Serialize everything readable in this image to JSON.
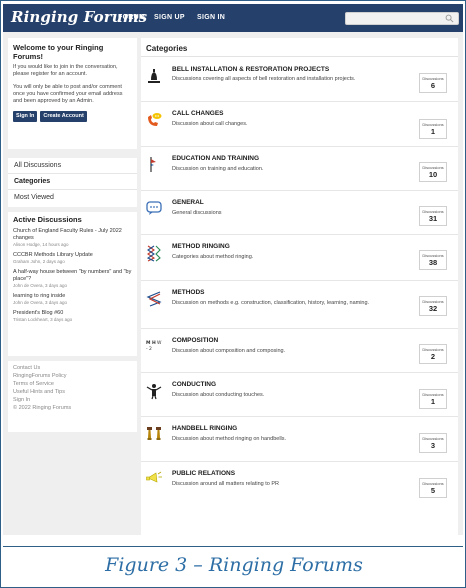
{
  "header": {
    "logo": "Ringing Forums",
    "nav": [
      "FORUM",
      "SIGN UP",
      "SIGN IN"
    ],
    "brand_color": "#25406a"
  },
  "welcome": {
    "title": "Welcome to your Ringing Forums!",
    "text1": "If you would like to join in the conversation, please register for an account.",
    "text2": "You will only be able to post and/or comment once you have confirmed your email address and been approved by an Admin.",
    "sign_in": "Sign In",
    "create_account": "Create Account"
  },
  "sidebar_nav": [
    {
      "label": "All Discussions"
    },
    {
      "label": "Categories"
    },
    {
      "label": "Most Viewed"
    }
  ],
  "active": {
    "title": "Active Discussions",
    "items": [
      {
        "title": "Church of England Faculty Rules - July 2022 changes",
        "meta": "Alison Hodge, 14 hours ago"
      },
      {
        "title": "CCCBR Methods Library Update",
        "meta": "Graham John, 2 days ago"
      },
      {
        "title": "A half-way house between \"by numbers\" and \"by place\"?",
        "meta": "John de Overa, 3 days ago"
      },
      {
        "title": "learning to ring inside",
        "meta": "John de Overa, 3 days ago"
      },
      {
        "title": "President's Blog #60",
        "meta": "Tristan Lockheart, 3 days ago"
      }
    ]
  },
  "footer": {
    "links": [
      "Contact Us",
      "RingingForums Policy",
      "Terms of Service",
      "Useful Hints and Tips",
      "Sign In"
    ],
    "copyright": "© 2022 Ringing Forums"
  },
  "main": {
    "title": "Categories",
    "discussions_label": "Discussions",
    "categories": [
      {
        "name": "BELL INSTALLATION & RESTORATION PROJECTS",
        "desc": "Discussions covering all aspects of bell restoration and installation projects.",
        "count": "6",
        "icon": "bell-frame-icon"
      },
      {
        "name": "CALL CHANGES",
        "desc": "Discussion about call changes.",
        "count": "1",
        "icon": "phone-chat-icon"
      },
      {
        "name": "EDUCATION AND TRAINING",
        "desc": "Discussion on training and education.",
        "count": "10",
        "icon": "bell-rope-icon"
      },
      {
        "name": "GENERAL",
        "desc": "General discussions",
        "count": "31",
        "icon": "chat-bubble-icon"
      },
      {
        "name": "METHOD RINGING",
        "desc": "Categories about method ringing.",
        "count": "38",
        "icon": "method-lines-icon"
      },
      {
        "name": "METHODS",
        "desc": "Discussion on methods e.g. construction, classification, history, learning, naming.",
        "count": "32",
        "icon": "method-blue-line-icon"
      },
      {
        "name": "COMPOSITION",
        "desc": "Discussion about composition and composing.",
        "count": "2",
        "icon": "composition-icon"
      },
      {
        "name": "CONDUCTING",
        "desc": "Discussion about conducting touches.",
        "count": "1",
        "icon": "conductor-icon"
      },
      {
        "name": "HANDBELL RINGING",
        "desc": "Discussion about method ringing on handbells.",
        "count": "3",
        "icon": "handbells-icon"
      },
      {
        "name": "PUBLIC RELATIONS",
        "desc": "Discussion around all matters relating to PR",
        "count": "5",
        "icon": "megaphone-icon"
      }
    ]
  },
  "caption": "Figure 3 – Ringing Forums"
}
